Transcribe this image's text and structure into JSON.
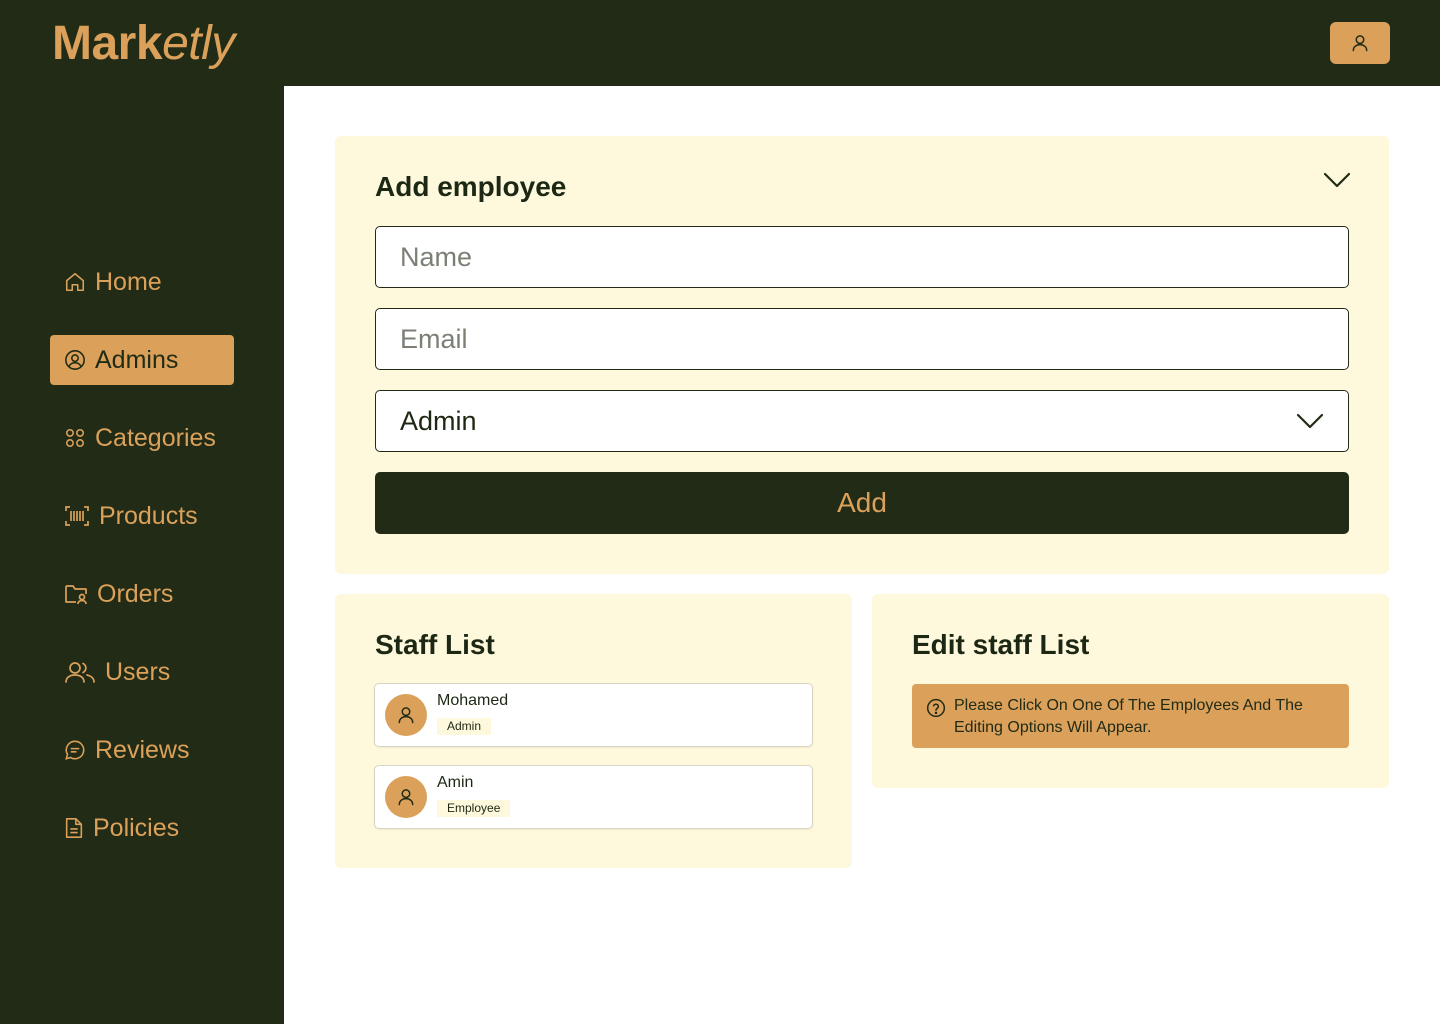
{
  "app": {
    "logo_part1": "Mark",
    "logo_part2": "etly"
  },
  "sidebar": {
    "items": [
      {
        "label": "Home",
        "icon": "home-icon"
      },
      {
        "label": "Admins",
        "icon": "user-circle-icon",
        "active": true
      },
      {
        "label": "Categories",
        "icon": "grid-circles-icon"
      },
      {
        "label": "Products",
        "icon": "barcode-icon"
      },
      {
        "label": "Orders",
        "icon": "folder-user-icon"
      },
      {
        "label": "Users",
        "icon": "users-icon"
      },
      {
        "label": "Reviews",
        "icon": "chat-bubble-icon"
      },
      {
        "label": "Policies",
        "icon": "document-icon"
      }
    ]
  },
  "add_employee": {
    "title": "Add employee",
    "name_placeholder": "Name",
    "email_placeholder": "Email",
    "role_value": "Admin",
    "add_label": "Add"
  },
  "staff_list": {
    "title": "Staff List",
    "members": [
      {
        "name": "Mohamed",
        "role": "Admin"
      },
      {
        "name": "Amin",
        "role": "Employee"
      }
    ]
  },
  "edit_staff": {
    "title": "Edit staff List",
    "notice": "Please Click On One Of The Employees And The Editing Options Will Appear."
  },
  "colors": {
    "dark": "#212b15",
    "accent": "#dba15b",
    "card": "#fef8dc"
  }
}
